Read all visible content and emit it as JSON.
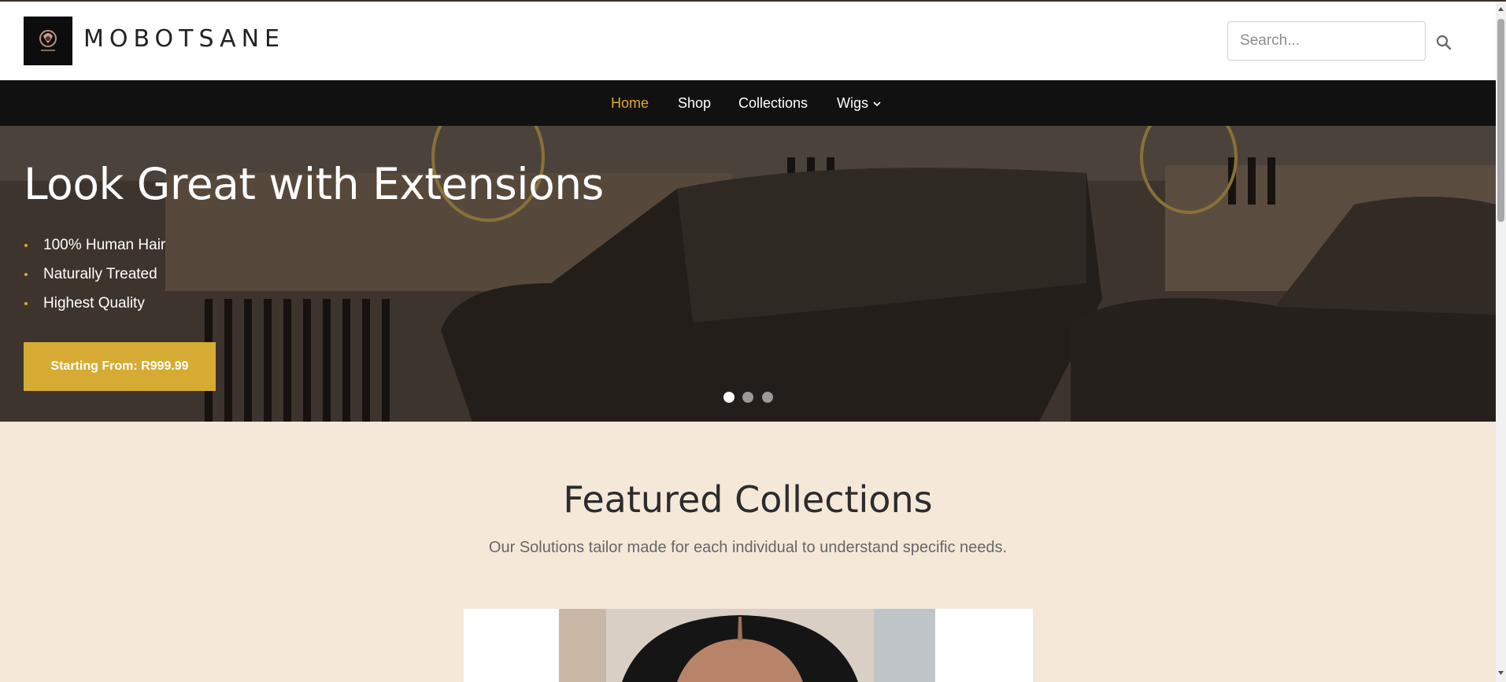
{
  "header": {
    "brand": "MOBOTSANE",
    "search_placeholder": "Search..."
  },
  "nav": {
    "items": [
      {
        "label": "Home",
        "active": true
      },
      {
        "label": "Shop"
      },
      {
        "label": "Collections"
      },
      {
        "label": "Wigs",
        "has_dropdown": true
      }
    ]
  },
  "hero": {
    "title": "Look Great with Extensions",
    "bullets": [
      "100% Human Hair",
      "Naturally Treated",
      "Highest Quality"
    ],
    "cta_label": "Starting From: R999.99",
    "slide_count": 3,
    "active_slide": 1
  },
  "featured": {
    "title": "Featured Collections",
    "subtitle": "Our Solutions tailor made for each individual to understand specific needs."
  },
  "colors": {
    "accent": "#e0a92e",
    "cta": "#d6ab33",
    "nav_bg": "#111111",
    "section_bg": "#f4e8d9"
  },
  "icons": [
    "logo-icon",
    "search-icon",
    "chevron-down-icon"
  ]
}
